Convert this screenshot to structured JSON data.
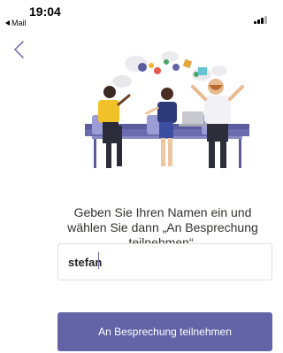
{
  "status_bar": {
    "time": "19:04",
    "back_app_label": "Mail"
  },
  "nav": {
    "back_icon": "chevron-left-icon"
  },
  "illustration": "meeting-people-illustration",
  "instruction_text": "Geben Sie Ihren Namen ein und wählen Sie dann „An Besprechung teilnehmen“.",
  "name_input": {
    "value": "stefan"
  },
  "join_button_label": "An Besprechung teilnehmen",
  "colors": {
    "accent": "#6264a7",
    "text": "#323130"
  }
}
